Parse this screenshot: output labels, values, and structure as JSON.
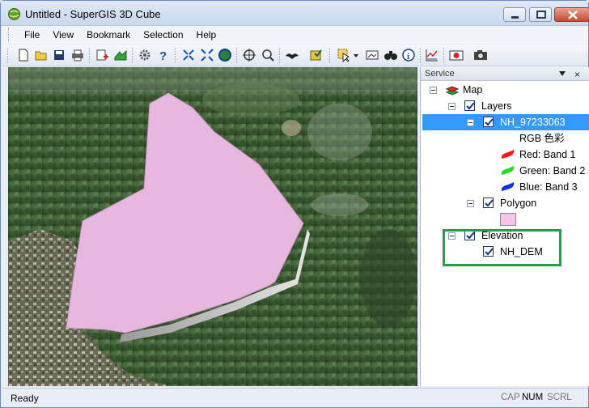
{
  "window": {
    "title": "Untitled - SuperGIS 3D Cube"
  },
  "menu": {
    "items": [
      "File",
      "View",
      "Bookmark",
      "Selection",
      "Help"
    ]
  },
  "toolbar": {
    "icons": [
      "new-icon",
      "open-icon",
      "save-icon",
      "print-icon",
      "add-layer-icon",
      "add-data-icon",
      "settings-icon",
      "help-icon",
      "zoom-in-icon",
      "zoom-out-icon",
      "full-extent-icon",
      "pan-icon",
      "zoom-tool-icon",
      "fly-icon",
      "catalog-icon",
      "select-icon",
      "dropdown-icon",
      "image-icon",
      "find-icon",
      "identify-icon",
      "chart-icon",
      "record-icon",
      "camera-icon"
    ]
  },
  "service_panel": {
    "title": "Service",
    "tree": {
      "map": "Map",
      "layers": "Layers",
      "raster_layer": "NH_97233063",
      "rgb_label": "RGB 色彩",
      "red_band": "Red: Band 1",
      "green_band": "Green: Band 2",
      "blue_band": "Blue: Band 3",
      "polygon": "Polygon",
      "elevation": "Elevation",
      "dem": "NH_DEM"
    }
  },
  "colors": {
    "selection": "#3399ff",
    "polygon_fill": "#e8b7e0",
    "highlight_box": "#1fa14a"
  },
  "status": {
    "text": "Ready",
    "caps": "CAP",
    "num": "NUM",
    "scroll": "SCRL"
  }
}
